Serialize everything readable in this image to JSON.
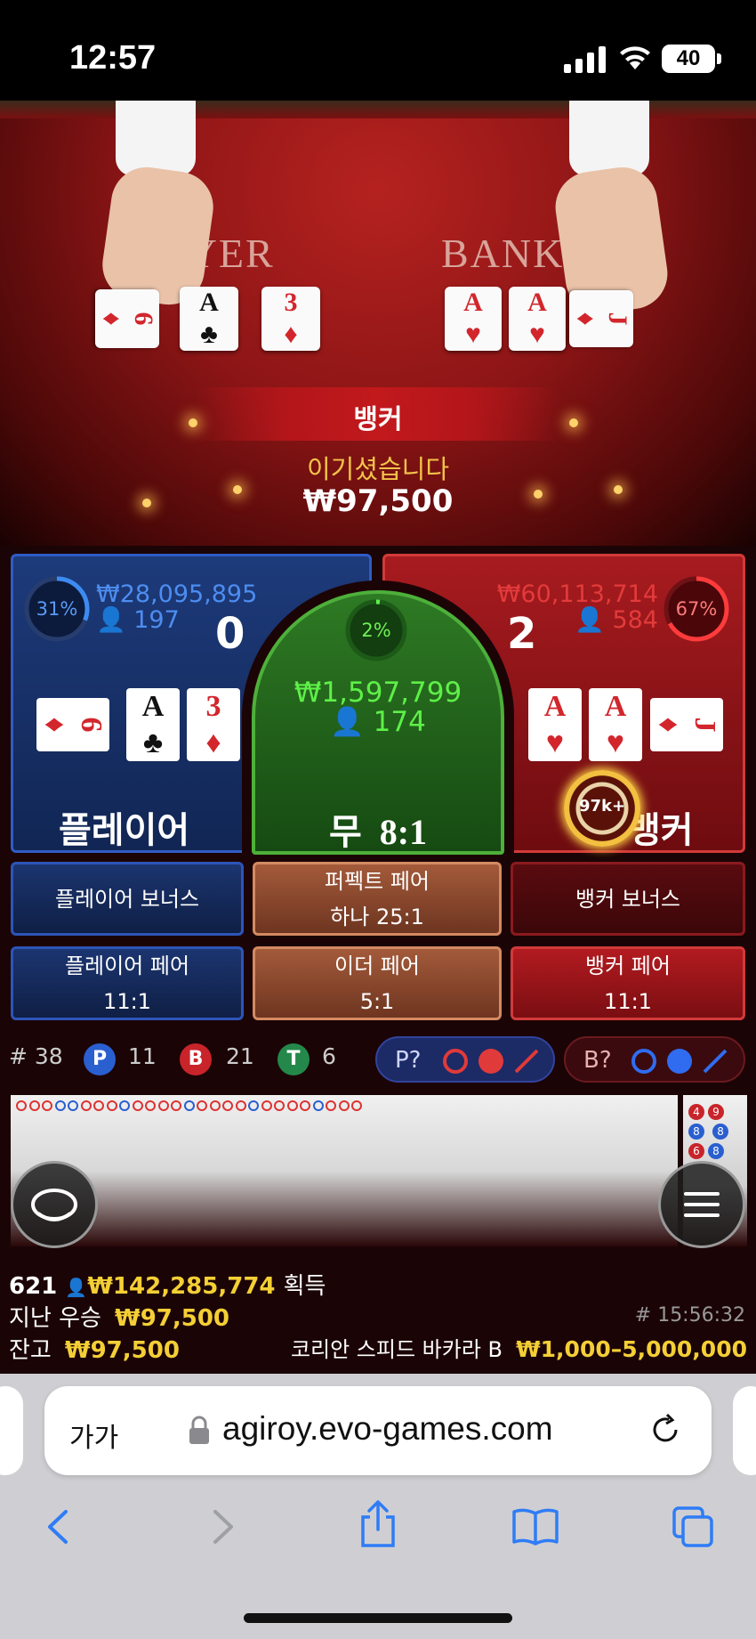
{
  "status_bar": {
    "time": "12:57",
    "battery": "40"
  },
  "table": {
    "player_label": "PLAYER",
    "banker_label": "BANKER",
    "player_cards": [
      {
        "rank": "6",
        "suit": "♦",
        "red": true
      },
      {
        "rank": "A",
        "suit": "♣",
        "red": false
      },
      {
        "rank": "3",
        "suit": "♦",
        "red": true
      }
    ],
    "banker_cards": [
      {
        "rank": "A",
        "suit": "♥",
        "red": true
      },
      {
        "rank": "A",
        "suit": "♥",
        "red": true
      },
      {
        "rank": "J",
        "suit": "♦",
        "red": true
      }
    ]
  },
  "result": {
    "winner": "뱅커",
    "message": "이기셨습니다",
    "amount": "₩97,500"
  },
  "player_zone": {
    "percent": "31%",
    "percent_value": 31,
    "total_bet": "₩28,095,895",
    "bettors": "197",
    "score": "0",
    "label": "플레이어",
    "cards": [
      {
        "rank": "6",
        "suit": "♦",
        "red": true
      },
      {
        "rank": "A",
        "suit": "♣",
        "red": false
      },
      {
        "rank": "3",
        "suit": "♦",
        "red": true
      }
    ]
  },
  "tie_zone": {
    "percent": "2%",
    "percent_value": 2,
    "total_bet": "₩1,597,799",
    "bettors": "174",
    "label": "무",
    "payout": "8:1"
  },
  "banker_zone": {
    "percent": "67%",
    "percent_value": 67,
    "total_bet": "₩60,113,714",
    "bettors": "584",
    "score": "2",
    "label": "뱅커",
    "chip": "97k+",
    "cards": [
      {
        "rank": "A",
        "suit": "♥",
        "red": true
      },
      {
        "rank": "A",
        "suit": "♥",
        "red": true
      },
      {
        "rank": "J",
        "suit": "♦",
        "red": true
      }
    ]
  },
  "side_bets": {
    "player_bonus": "플레이어 보너스",
    "perfect_pair": "퍼펙트 페어",
    "perfect_pair_payout": "하나 25:1",
    "banker_bonus": "뱅커 보너스",
    "player_pair": "플레이어 페어",
    "player_pair_payout": "11:1",
    "either_pair": "이더 페어",
    "either_pair_payout": "5:1",
    "banker_pair": "뱅커 페어",
    "banker_pair_payout": "11:1"
  },
  "stats": {
    "round": "# 38",
    "p_badge": "P",
    "p_count": "11",
    "b_badge": "B",
    "b_count": "21",
    "t_badge": "T",
    "t_count": "6",
    "player_predict": "P?",
    "banker_predict": "B?"
  },
  "footer": {
    "winners": "621",
    "total_won": "₩142,285,774",
    "won_label": "획득",
    "last_win_label": "지난 우승",
    "last_win": "₩97,500",
    "round_time": "# 15:56:32",
    "balance_label": "잔고",
    "balance": "₩97,500",
    "table_name": "코리안 스피드 바카라 B",
    "limits": "₩1,000–5,000,000"
  },
  "browser": {
    "aa": "가가",
    "url": "agiroy.evo-games.com"
  }
}
